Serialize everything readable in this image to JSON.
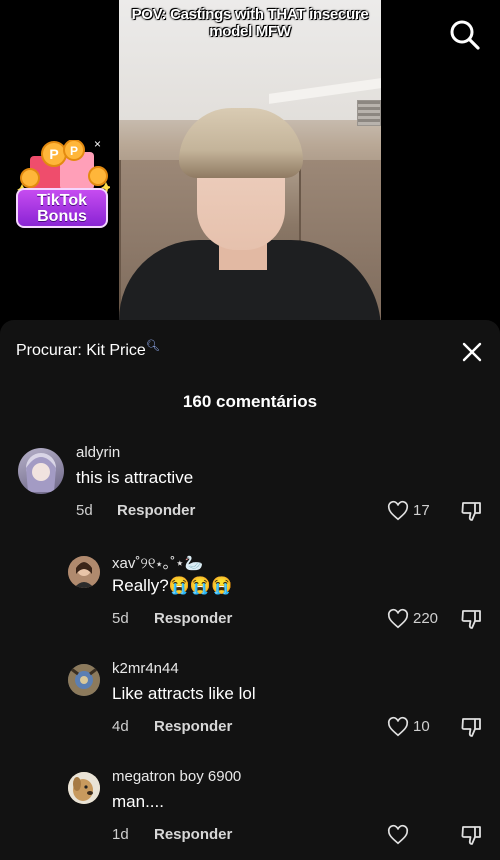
{
  "video": {
    "caption": "POV: Castings with THAT insecure model MFW"
  },
  "bonus": {
    "label": "TikTok Bonus",
    "close_glyph": "×"
  },
  "sheet": {
    "search_prefix": "Procurar:",
    "search_query": "Kit Price",
    "comment_count_label": "160 comentários"
  },
  "comments": [
    {
      "username": "aldyrin",
      "text": "this is attractive",
      "age": "5d",
      "reply_label": "Responder",
      "likes": "17"
    },
    {
      "username": "xav˚୨୧⋆｡˚⋆🦢",
      "text": "Really?😭😭😭",
      "age": "5d",
      "reply_label": "Responder",
      "likes": "220"
    },
    {
      "username": "k2mr4n44",
      "text": "Like attracts like lol",
      "age": "4d",
      "reply_label": "Responder",
      "likes": "10"
    },
    {
      "username": "megatron boy 6900",
      "text": "man....",
      "age": "1d",
      "reply_label": "Responder",
      "likes": ""
    }
  ],
  "colors": {
    "sheet_bg": "#121212",
    "bonus_purple": "#8a24d4"
  },
  "icons": [
    "search-icon",
    "close-icon",
    "heart-icon",
    "dislike-icon"
  ]
}
